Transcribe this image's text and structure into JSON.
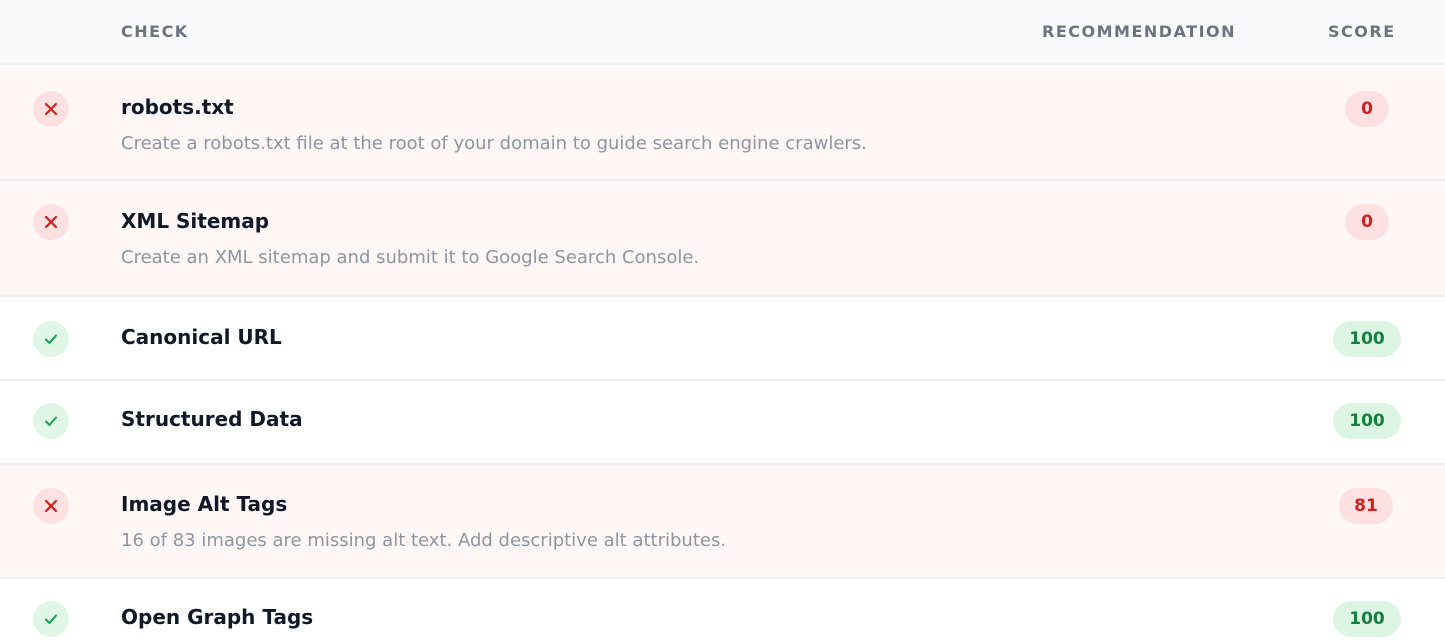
{
  "header": {
    "check": "CHECK",
    "recommendation": "RECOMMENDATION",
    "score": "SCORE"
  },
  "colors": {
    "fail_text": "#d11f1f",
    "fail_bg": "#fde0df",
    "pass_text": "#15803d",
    "pass_bg": "#dcf5e3",
    "fail_row_bg": "#fff7f6"
  },
  "rows": [
    {
      "status": "fail",
      "icon": "x-icon",
      "title": "robots.txt",
      "recommendation": "Create a robots.txt file at the root of your domain to guide search engine crawlers.",
      "score": "0"
    },
    {
      "status": "fail",
      "icon": "x-icon",
      "title": "XML Sitemap",
      "recommendation": "Create an XML sitemap and submit it to Google Search Console.",
      "score": "0"
    },
    {
      "status": "pass",
      "icon": "check-icon",
      "title": "Canonical URL",
      "recommendation": "",
      "score": "100"
    },
    {
      "status": "pass",
      "icon": "check-icon",
      "title": "Structured Data",
      "recommendation": "",
      "score": "100"
    },
    {
      "status": "fail",
      "icon": "x-icon",
      "title": "Image Alt Tags",
      "recommendation": "16 of 83 images are missing alt text. Add descriptive alt attributes.",
      "score": "81"
    },
    {
      "status": "pass",
      "icon": "check-icon",
      "title": "Open Graph Tags",
      "recommendation": "",
      "score": "100"
    }
  ]
}
